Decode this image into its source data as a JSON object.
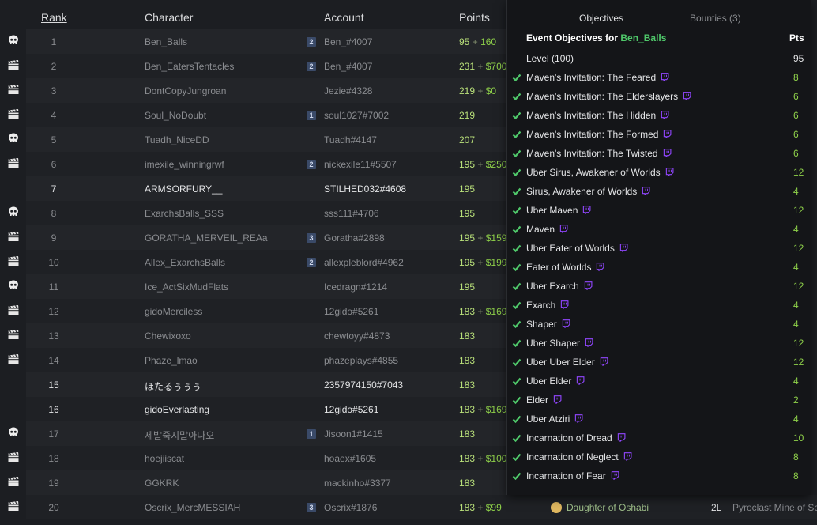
{
  "columns": {
    "rank": "Rank",
    "character": "Character",
    "account": "Account",
    "points": "Points"
  },
  "rows": [
    {
      "rank": "1",
      "character": "Ben_Balls",
      "badge": "2",
      "account": "Ben_#4007",
      "points": "95",
      "plus": "+",
      "money": "160",
      "icon": "skull-icon"
    },
    {
      "rank": "2",
      "character": "Ben_EatersTentacles",
      "badge": "2",
      "account": "Ben_#4007",
      "points": "231",
      "plus": "+",
      "money": "$700",
      "icon": "clapperboard-icon"
    },
    {
      "rank": "3",
      "character": "DontCopyJungroan",
      "badge": "",
      "account": "Jezie#4328",
      "points": "219",
      "plus": "+",
      "money": "$0",
      "icon": "clapperboard-icon"
    },
    {
      "rank": "4",
      "character": "Soul_NoDoubt",
      "badge": "1",
      "account": "soul1027#7002",
      "points": "219",
      "plus": "",
      "money": "",
      "icon": "clapperboard-icon"
    },
    {
      "rank": "5",
      "character": "Tuadh_NiceDD",
      "badge": "",
      "account": "Tuadh#4147",
      "points": "207",
      "plus": "",
      "money": "",
      "icon": "skull-icon"
    },
    {
      "rank": "6",
      "character": "imexile_winningrwf",
      "badge": "2",
      "account": "nickexile11#5507",
      "points": "195",
      "plus": "+",
      "money": "$250",
      "icon": "clapperboard-icon"
    },
    {
      "rank": "7",
      "character": "ARMSORFURY__",
      "badge": "",
      "account": "STILHED032#4608",
      "points": "195",
      "plus": "",
      "money": "",
      "icon": "",
      "active": true
    },
    {
      "rank": "8",
      "character": "ExarchsBalls_SSS",
      "badge": "",
      "account": "sss111#4706",
      "points": "195",
      "plus": "",
      "money": "",
      "icon": "skull-icon"
    },
    {
      "rank": "9",
      "character": "GORATHA_MERVEIL_REAa",
      "badge": "3",
      "account": "Goratha#2898",
      "points": "195",
      "plus": "+",
      "money": "$159",
      "icon": "clapperboard-icon"
    },
    {
      "rank": "10",
      "character": "Allex_ExarchsBalls",
      "badge": "2",
      "account": "allexpleblord#4962",
      "points": "195",
      "plus": "+",
      "money": "$199",
      "icon": "clapperboard-icon"
    },
    {
      "rank": "11",
      "character": "Ice_ActSixMudFlats",
      "badge": "",
      "account": "Icedragn#1214",
      "points": "195",
      "plus": "",
      "money": "",
      "icon": "skull-icon"
    },
    {
      "rank": "12",
      "character": "gidoMerciless",
      "badge": "",
      "account": "12gido#5261",
      "points": "183",
      "plus": "+",
      "money": "$169",
      "icon": "clapperboard-icon"
    },
    {
      "rank": "13",
      "character": "Chewixoxo",
      "badge": "",
      "account": "chewtoyy#4873",
      "points": "183",
      "plus": "",
      "money": "",
      "icon": "clapperboard-icon"
    },
    {
      "rank": "14",
      "character": "Phaze_lmao",
      "badge": "",
      "account": "phazeplays#4855",
      "points": "183",
      "plus": "",
      "money": "",
      "icon": "clapperboard-icon"
    },
    {
      "rank": "15",
      "character": "ほたるぅぅぅ",
      "badge": "",
      "account": "2357974150#7043",
      "points": "183",
      "plus": "",
      "money": "",
      "icon": "",
      "active": true
    },
    {
      "rank": "16",
      "character": "gidoEverlasting",
      "badge": "",
      "account": "12gido#5261",
      "points": "183",
      "plus": "+",
      "money": "$169",
      "icon": "",
      "active": true
    },
    {
      "rank": "17",
      "character": "제발죽지말아다오",
      "badge": "1",
      "account": "Jisoon1#1415",
      "points": "183",
      "plus": "",
      "money": "",
      "icon": "skull-icon"
    },
    {
      "rank": "18",
      "character": "hoejiiscat",
      "badge": "",
      "account": "hoaex#1605",
      "points": "183",
      "plus": "+",
      "money": "$100",
      "icon": "clapperboard-icon"
    },
    {
      "rank": "19",
      "character": "GGKRK",
      "badge": "",
      "account": "mackinho#3377",
      "points": "183",
      "plus": "",
      "money": "",
      "icon": "clapperboard-icon"
    },
    {
      "rank": "20",
      "character": "Oscrix_MercMESSIAH",
      "badge": "3",
      "account": "Oscrix#1876",
      "points": "183",
      "plus": "+",
      "money": "$99",
      "icon": "clapperboard-icon",
      "ascendancy": "Daughter of Oshabi",
      "level": "2L",
      "map": "Pyroclast Mine of Se"
    }
  ],
  "panel": {
    "tab_objectives": "Objectives",
    "tab_bounties": "Bounties (3)",
    "title_prefix": "Event Objectives for",
    "title_character": "Ben_Balls",
    "pts_header": "Pts",
    "level_label": "Level (100)",
    "level_points": "95",
    "objectives": [
      {
        "name": "Maven's Invitation: The Feared",
        "pts": "8"
      },
      {
        "name": "Maven's Invitation: The Elderslayers",
        "pts": "6"
      },
      {
        "name": "Maven's Invitation: The Hidden",
        "pts": "6"
      },
      {
        "name": "Maven's Invitation: The Formed",
        "pts": "6"
      },
      {
        "name": "Maven's Invitation: The Twisted",
        "pts": "6"
      },
      {
        "name": "Uber Sirus, Awakener of Worlds",
        "pts": "12"
      },
      {
        "name": "Sirus, Awakener of Worlds",
        "pts": "4"
      },
      {
        "name": "Uber Maven",
        "pts": "12"
      },
      {
        "name": "Maven",
        "pts": "4"
      },
      {
        "name": "Uber Eater of Worlds",
        "pts": "12"
      },
      {
        "name": "Eater of Worlds",
        "pts": "4"
      },
      {
        "name": "Uber Exarch",
        "pts": "12"
      },
      {
        "name": "Exarch",
        "pts": "4"
      },
      {
        "name": "Shaper",
        "pts": "4"
      },
      {
        "name": "Uber Shaper",
        "pts": "12"
      },
      {
        "name": "Uber Uber Elder",
        "pts": "12"
      },
      {
        "name": "Uber Elder",
        "pts": "4"
      },
      {
        "name": "Elder",
        "pts": "2"
      },
      {
        "name": "Uber Atziri",
        "pts": "4"
      },
      {
        "name": "Incarnation of Dread",
        "pts": "10"
      },
      {
        "name": "Incarnation of Neglect",
        "pts": "8"
      },
      {
        "name": "Incarnation of Fear",
        "pts": "8"
      }
    ]
  },
  "colors": {
    "accent_green": "#4fc86a",
    "points_green": "#8fd14a",
    "twitch_purple": "#9146ff",
    "badge_blue": "#3a4a68"
  }
}
